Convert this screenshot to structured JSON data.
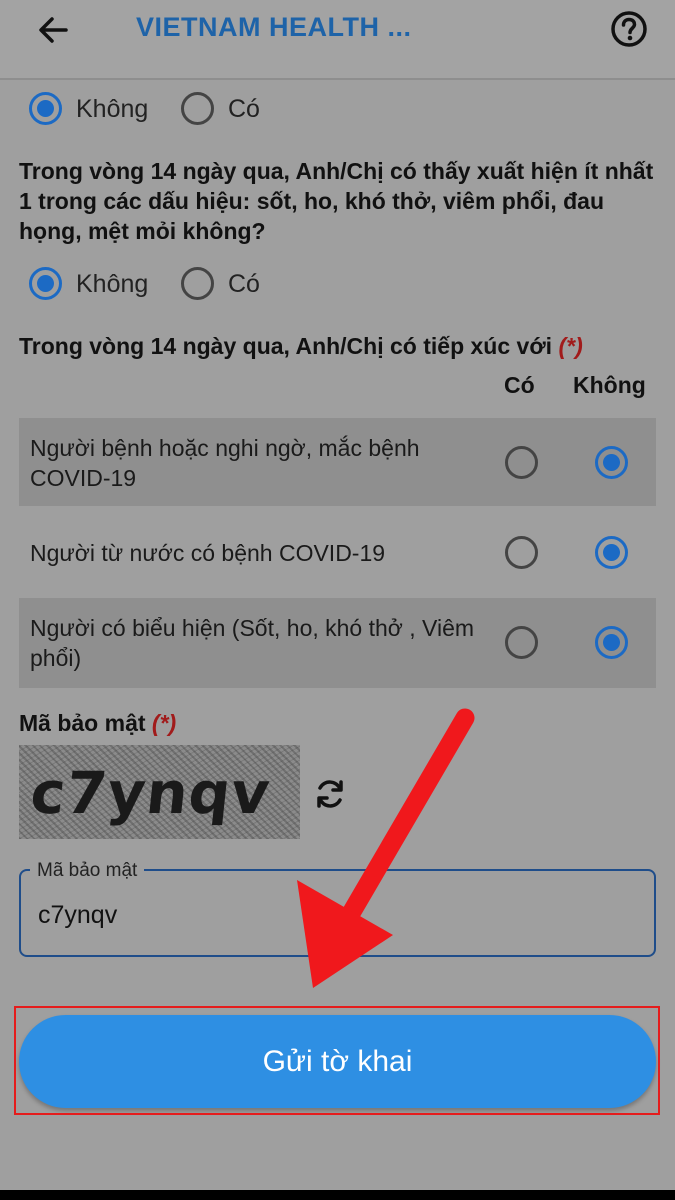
{
  "header": {
    "title": "VIETNAM HEALTH ...",
    "back_icon": "arrow-left-icon",
    "help_icon": "question-circle-icon"
  },
  "prev_question": {
    "options": [
      "Không",
      "Có"
    ],
    "selected": "Không"
  },
  "symptom_question": {
    "text": "Trong vòng 14 ngày qua, Anh/Chị có thấy xuất hiện ít nhất 1 trong các dấu hiệu: sốt, ho, khó thở, viêm phổi, đau họng, mệt mỏi không?",
    "options": [
      "Không",
      "Có"
    ],
    "selected": "Không"
  },
  "contact_question": {
    "text": "Trong vòng 14 ngày qua, Anh/Chị có tiếp xúc với",
    "required_mark": "(*)",
    "col_yes": "Có",
    "col_no": "Không",
    "rows": [
      {
        "label": "Người bệnh hoặc nghi ngờ, mắc bệnh COVID-19",
        "selected": "Không"
      },
      {
        "label": "Người từ nước có bệnh COVID-19",
        "selected": "Không"
      },
      {
        "label": "Người có biểu hiện (Sốt, ho, khó thở , Viêm phổi)",
        "selected": "Không"
      }
    ]
  },
  "captcha": {
    "label": "Mã bảo mật",
    "required_mark": "(*)",
    "image_text": "c7ynqv",
    "refresh_icon": "refresh-icon",
    "field_label": "Mã bảo mật",
    "field_value": "c7ynqv"
  },
  "submit": {
    "label": "Gửi tờ khai"
  },
  "colors": {
    "accent": "#2e8fe3",
    "radio_selected": "#1c6ac4",
    "title": "#1e63a8",
    "required": "#a11b1b",
    "annotation": "#e51c1c"
  }
}
